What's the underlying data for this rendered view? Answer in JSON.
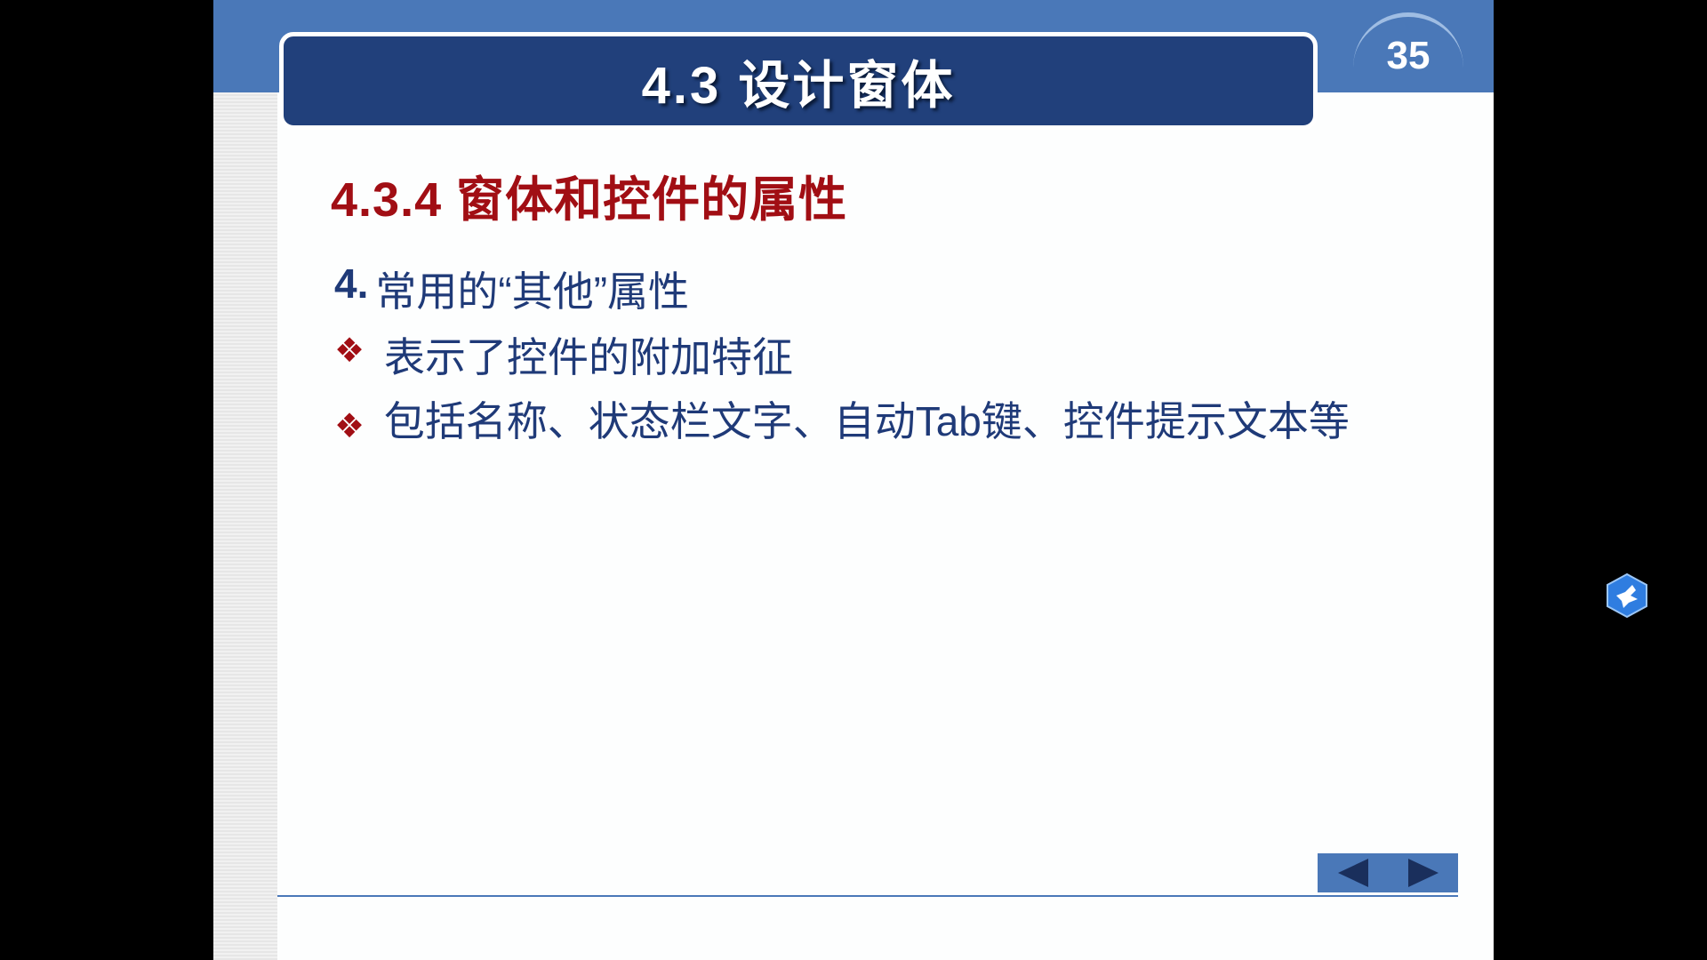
{
  "slide": {
    "title": "4.3 设计窗体",
    "page_number": "35",
    "section_heading": "4.3.4 窗体和控件的属性",
    "lines": [
      {
        "prefix": "4.",
        "text": "常用的“其他”属性"
      },
      {
        "bullet": "❖",
        "text": "表示了控件的附加特征"
      },
      {
        "bullet": "❖",
        "text": "包括名称、状态栏文字、自动Tab键、控件提示文本等"
      }
    ]
  },
  "navigation": {
    "prev_icon": "triangle-left-icon",
    "next_icon": "triangle-right-icon"
  },
  "widget": {
    "icon": "bird-hexagon-icon"
  },
  "colors": {
    "title_bar": "#21407b",
    "band": "#4a78b8",
    "heading": "#a10e14",
    "body_text": "#1f3a78"
  }
}
